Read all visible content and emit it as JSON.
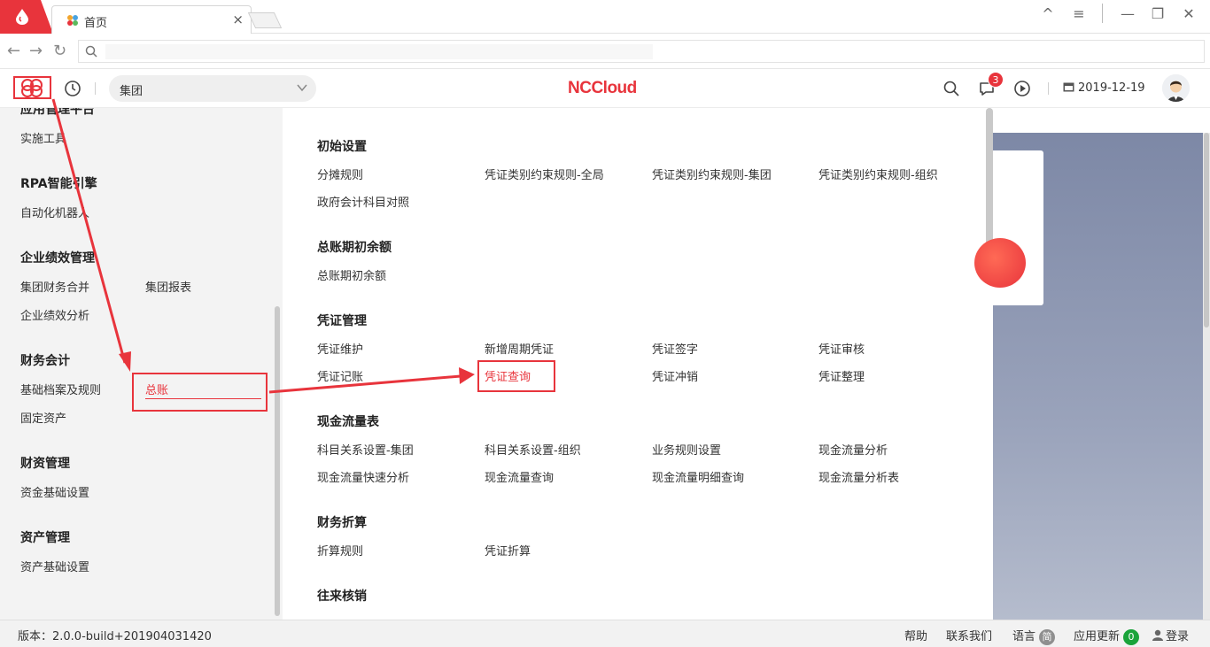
{
  "browser": {
    "tab_title": "首页",
    "tab_close": "×",
    "window_controls": [
      "^",
      "≡",
      "—",
      "❐",
      "✕"
    ]
  },
  "header": {
    "group_select": "集团",
    "logo_text": "NCCloud",
    "message_badge": "3",
    "date": "2019-12-19"
  },
  "left_panel": {
    "categories": [
      {
        "title": "应用管理平台",
        "items": [
          {
            "label": "实施工具"
          }
        ]
      },
      {
        "title": "RPA智能引擎",
        "items": [
          {
            "label": "自动化机器人"
          }
        ]
      },
      {
        "title": "企业绩效管理",
        "items": [
          {
            "label": "集团财务合并"
          },
          {
            "label": "集团报表"
          },
          {
            "label": "企业绩效分析"
          }
        ]
      },
      {
        "title": "财务会计",
        "items": [
          {
            "label": "基础档案及规则"
          },
          {
            "label": "总账",
            "active": true
          },
          {
            "label": "固定资产"
          }
        ]
      },
      {
        "title": "财资管理",
        "items": [
          {
            "label": "资金基础设置"
          }
        ]
      },
      {
        "title": "资产管理",
        "items": [
          {
            "label": "资产基础设置"
          }
        ]
      }
    ]
  },
  "menu_panel": {
    "sections": [
      {
        "title": "初始设置",
        "items": [
          "分摊规则",
          "凭证类别约束规则-全局",
          "凭证类别约束规则-集团",
          "凭证类别约束规则-组织",
          "政府会计科目对照"
        ]
      },
      {
        "title": "总账期初余额",
        "items": [
          "总账期初余额"
        ]
      },
      {
        "title": "凭证管理",
        "items": [
          "凭证维护",
          "新增周期凭证",
          "凭证签字",
          "凭证审核",
          "凭证记账",
          "凭证查询",
          "凭证冲销",
          "凭证整理"
        ]
      },
      {
        "title": "现金流量表",
        "items": [
          "科目关系设置-集团",
          "科目关系设置-组织",
          "业务规则设置",
          "现金流量分析",
          "现金流量快速分析",
          "现金流量查询",
          "现金流量明细查询",
          "现金流量分析表"
        ]
      },
      {
        "title": "财务折算",
        "items": [
          "折算规则",
          "凭证折算"
        ]
      },
      {
        "title": "往来核销",
        "items": []
      }
    ],
    "highlighted_item": "凭证查询"
  },
  "status_bar": {
    "version": "版本：2.0.0-build+201904031420",
    "help": "帮助",
    "contact": "联系我们",
    "language": "语言",
    "language_badge": "简",
    "update": "应用更新",
    "update_badge": "0",
    "login": "登录"
  },
  "colors": {
    "brand_red": "#e8343c",
    "update_green": "#1aa33a",
    "lang_gray": "#8f8f8f"
  }
}
